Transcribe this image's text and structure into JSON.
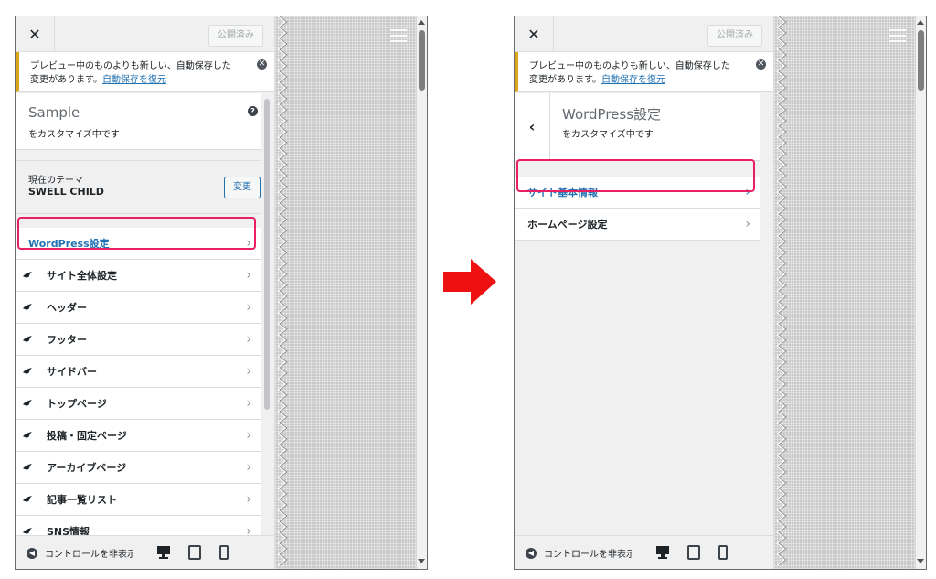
{
  "left": {
    "topbar": {
      "close": "✕",
      "publish": "公開済み"
    },
    "notice": {
      "text": "プレビュー中のものよりも新しい、自動保存した変更があります。",
      "link": "自動保存を復元",
      "dismiss": "✕"
    },
    "site": {
      "title": "Sample",
      "subtitle": "をカスタマイズ中です",
      "help": "?"
    },
    "theme": {
      "label": "現在のテーマ",
      "name": "SWELL CHILD",
      "change": "変更"
    },
    "menu": [
      {
        "label": "WordPress設定"
      },
      {
        "label": "サイト全体設定"
      },
      {
        "label": "ヘッダー"
      },
      {
        "label": "フッター"
      },
      {
        "label": "サイドバー"
      },
      {
        "label": "トップページ"
      },
      {
        "label": "投稿・固定ページ"
      },
      {
        "label": "アーカイブページ"
      },
      {
        "label": "記事一覧リスト"
      },
      {
        "label": "SNS情報"
      }
    ],
    "footer": {
      "collapse": "コントロールを非表示"
    }
  },
  "right": {
    "topbar": {
      "close": "✕",
      "publish": "公開済み"
    },
    "notice": {
      "text": "プレビュー中のものよりも新しい、自動保存した変更があります。",
      "link": "自動保存を復元",
      "dismiss": "✕"
    },
    "section": {
      "title": "WordPress設定",
      "subtitle": "をカスタマイズ中です",
      "back": "‹"
    },
    "menu": [
      {
        "label": "サイト基本情報"
      },
      {
        "label": "ホームページ設定"
      }
    ],
    "footer": {
      "collapse": "コントロールを非表示"
    }
  },
  "colors": {
    "highlight": "#e91e63",
    "arrow": "#ee1111",
    "link": "#2271b1",
    "notice_border": "#dba617"
  },
  "icons": [
    "close-icon",
    "dismiss-icon",
    "help-icon",
    "swell-bird-icon",
    "chevron-right-icon",
    "back-chevron-icon",
    "collapse-icon",
    "desktop-icon",
    "tablet-icon",
    "mobile-icon",
    "hamburger-icon",
    "right-arrow-icon"
  ]
}
